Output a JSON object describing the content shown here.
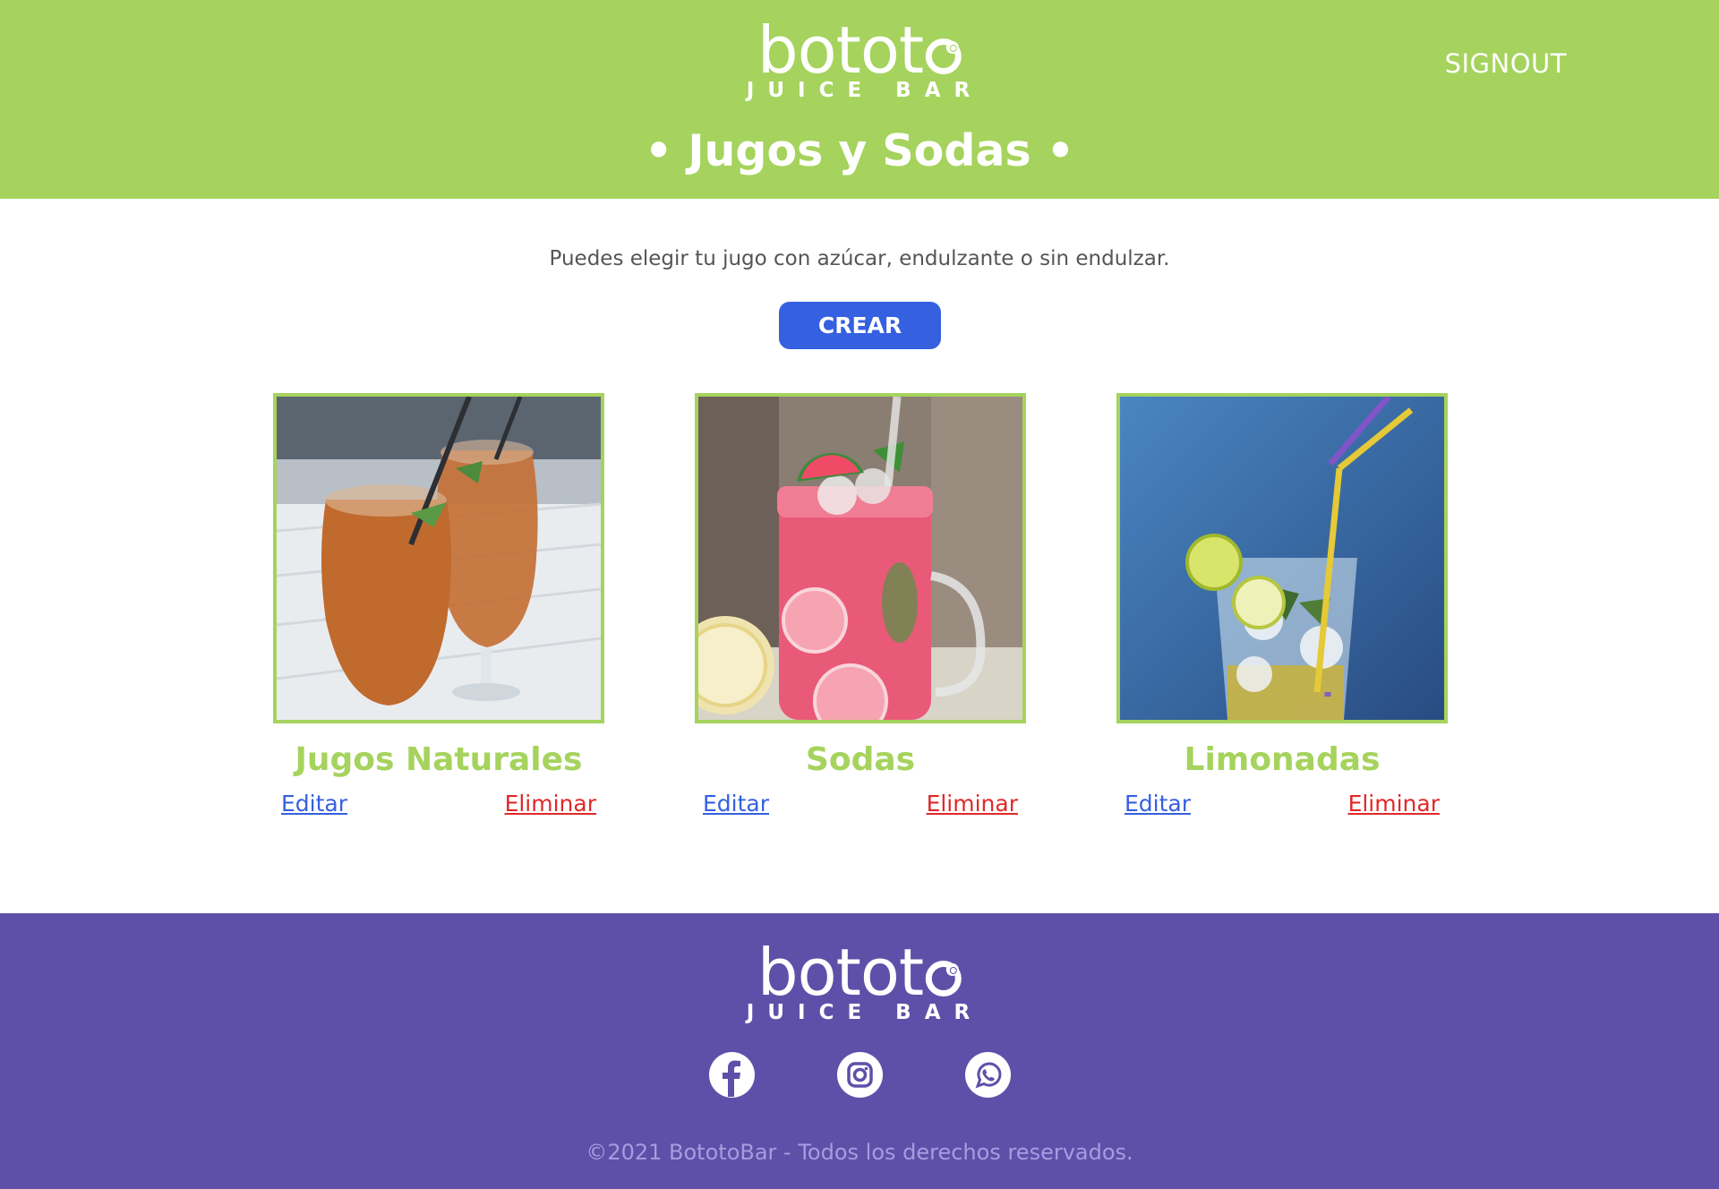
{
  "header": {
    "logo_word": "boto",
    "logo_tail": "t",
    "logo_sub": "JUICE BAR",
    "signout_label": "SIGNOUT",
    "title": "• Jugos y Sodas •"
  },
  "main": {
    "subtitle": "Puedes elegir tu jugo con azúcar, endulzante o sin endulzar.",
    "create_label": "CREAR",
    "cards": [
      {
        "title": "Jugos Naturales",
        "edit": "Editar",
        "delete": "Eliminar",
        "image": "orange-juice-glasses-photo"
      },
      {
        "title": "Sodas",
        "edit": "Editar",
        "delete": "Eliminar",
        "image": "pink-soda-jar-photo"
      },
      {
        "title": "Limonadas",
        "edit": "Editar",
        "delete": "Eliminar",
        "image": "lemonade-glass-photo"
      }
    ]
  },
  "footer": {
    "logo_word": "boto",
    "logo_tail": "t",
    "logo_sub": "JUICE BAR",
    "social": [
      "facebook-icon",
      "instagram-icon",
      "whatsapp-icon"
    ],
    "copyright": "©2021 BototoBar - Todos los derechos reservados."
  },
  "colors": {
    "header_green": "#a5d35d",
    "footer_purple": "#5e50a8",
    "button_blue": "#3560e0",
    "delete_red": "#e02929"
  }
}
